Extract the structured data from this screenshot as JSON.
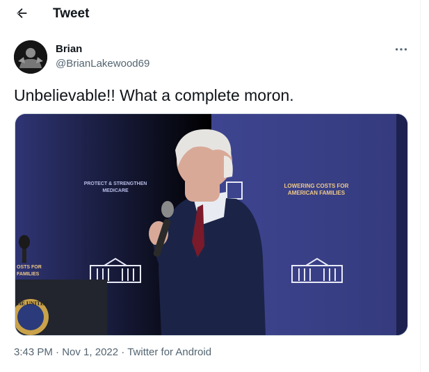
{
  "header": {
    "title": "Tweet",
    "back_icon": "arrow-left-icon"
  },
  "tweet": {
    "author_name": "Brian",
    "author_handle": "@BrianLakewood69",
    "text": "Unbelievable!! What a complete moron.",
    "time": "3:43 PM",
    "date": "Nov 1, 2022",
    "source": "Twitter for Android",
    "separator": "·",
    "more_icon": "more-horizontal-icon"
  },
  "media": {
    "backdrop_left_text_1": "PROTECT & STRENGTHEN",
    "backdrop_left_text_2": "MEDICARE",
    "backdrop_right_text_1": "LOWERING COSTS FOR",
    "backdrop_right_text_2": "AMERICAN FAMILIES",
    "backdrop_far_left_text_1": "OSTS FOR",
    "backdrop_far_left_text_2": "FAMILIES",
    "podium_seal_text": "THE UNITED",
    "colors": {
      "backdrop": "#3b4087",
      "suit": "#1b2447",
      "tie": "#7a1a2a",
      "hair": "#e6e4e0",
      "skin": "#d9a998"
    }
  }
}
